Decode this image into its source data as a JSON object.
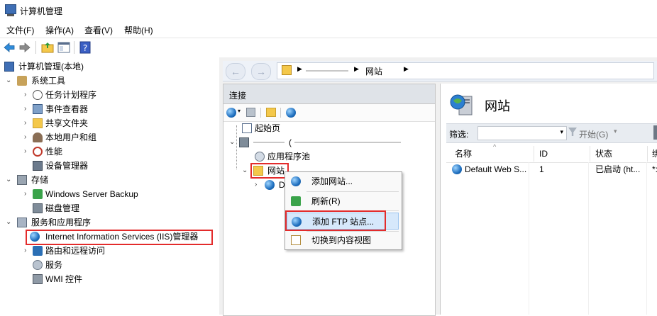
{
  "window": {
    "title": "计算机管理"
  },
  "menu": [
    "文件(F)",
    "操作(A)",
    "查看(V)",
    "帮助(H)"
  ],
  "left_tree": {
    "root": "计算机管理(本地)",
    "system_tools": "系统工具",
    "task_scheduler": "任务计划程序",
    "event_viewer": "事件查看器",
    "shared_folders": "共享文件夹",
    "local_users": "本地用户和组",
    "performance": "性能",
    "device_manager": "设备管理器",
    "storage": "存储",
    "windows_server_backup": "Windows Server Backup",
    "disk_management": "磁盘管理",
    "services_apps": "服务和应用程序",
    "iis_manager": "Internet Information Services (IIS)管理器",
    "routing": "路由和远程访问",
    "services": "服务",
    "wmi": "WMI 控件"
  },
  "address_bar": {
    "separator": "▶",
    "location": "网站"
  },
  "connections": {
    "header": "连接",
    "start_page": "起始页",
    "server_node": "(",
    "app_pools": "应用程序池",
    "sites": "网站",
    "default_site_truncated": "D"
  },
  "context_menu": {
    "add_website": "添加网站...",
    "refresh": "刷新(R)",
    "add_ftp": "添加 FTP 站点...",
    "switch_content_view": "切换到内容视图"
  },
  "sites_pane": {
    "title": "网站",
    "filter_label": "筛选:",
    "start_label": "开始(G)",
    "columns": [
      "名称",
      "ID",
      "状态",
      "绑"
    ],
    "rows": [
      {
        "name": "Default Web S...",
        "id": "1",
        "status": "已启动 (ht...",
        "binding": "*:"
      }
    ]
  }
}
